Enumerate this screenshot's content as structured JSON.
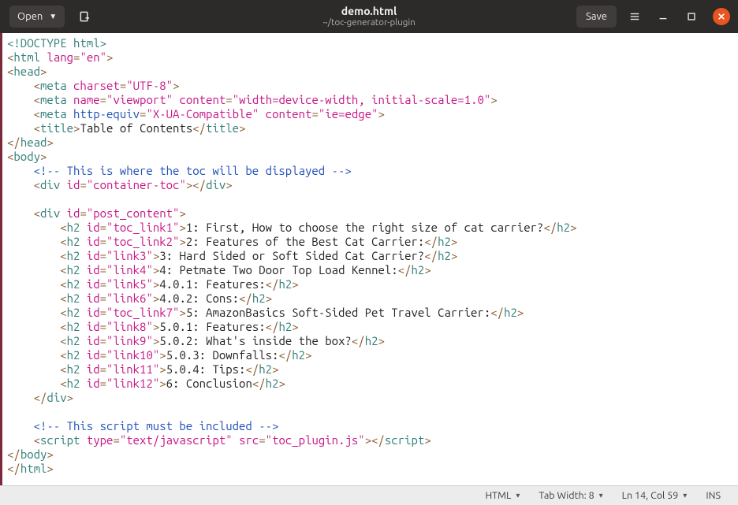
{
  "titlebar": {
    "open_label": "Open",
    "filename": "demo.html",
    "filepath": "~/toc-generator-plugin",
    "save_label": "Save"
  },
  "code": {
    "root_open_doctype": "<!DOCTYPE html>",
    "html_open_tag": "html",
    "html_lang_attr": "lang",
    "html_lang_val": "\"en\"",
    "head_tag": "head",
    "meta_tag": "meta",
    "charset_attr": "charset",
    "charset_val": "\"UTF-8\"",
    "name_attr": "name",
    "viewport_val": "\"viewport\"",
    "content_attr": "content",
    "viewport_content_val": "\"width=device-width, initial-scale=1.0\"",
    "httpeq_attr": "http-equiv",
    "xua_val": "\"X-UA-Compatible\"",
    "ieedge_val": "\"ie=edge\"",
    "title_tag": "title",
    "title_text": "Table of Contents",
    "body_tag": "body",
    "comment_toc": "<!-- This is where the toc will be displayed -->",
    "div_tag": "div",
    "id_attr": "id",
    "container_toc_val": "\"container-toc\"",
    "post_content_val": "\"post_content\"",
    "h2_tag": "h2",
    "lines": [
      {
        "id": "\"toc_link1\"",
        "text": "1: First, How to choose the right size of cat carrier?"
      },
      {
        "id": "\"toc_link2\"",
        "text": "2: Features of the Best Cat Carrier:"
      },
      {
        "id": "\"link3\"",
        "text": "3: Hard Sided or Soft Sided Cat Carrier?"
      },
      {
        "id": "\"link4\"",
        "text": "4: Petmate Two Door Top Load Kennel:"
      },
      {
        "id": "\"link5\"",
        "text": "4.0.1: Features:"
      },
      {
        "id": "\"link6\"",
        "text": "4.0.2: Cons:"
      },
      {
        "id": "\"toc_link7\"",
        "text": "5: AmazonBasics Soft-Sided Pet Travel Carrier:"
      },
      {
        "id": "\"link8\"",
        "text": "5.0.1: Features:"
      },
      {
        "id": "\"link9\"",
        "text": "5.0.2: What's inside the box?"
      },
      {
        "id": "\"link10\"",
        "text": "5.0.3: Downfalls:"
      },
      {
        "id": "\"link11\"",
        "text": "5.0.4: Tips:"
      },
      {
        "id": "\"link12\"",
        "text": "6: Conclusion"
      }
    ],
    "comment_script": "<!-- This script must be included -->",
    "script_tag": "script",
    "type_attr": "type",
    "type_val": "\"text/javascript\"",
    "src_attr": "src",
    "src_val": "\"toc_plugin.js\""
  },
  "status": {
    "language": "HTML",
    "tabwidth": "Tab Width: 8",
    "cursor": "Ln 14, Col 59",
    "insert": "INS"
  }
}
